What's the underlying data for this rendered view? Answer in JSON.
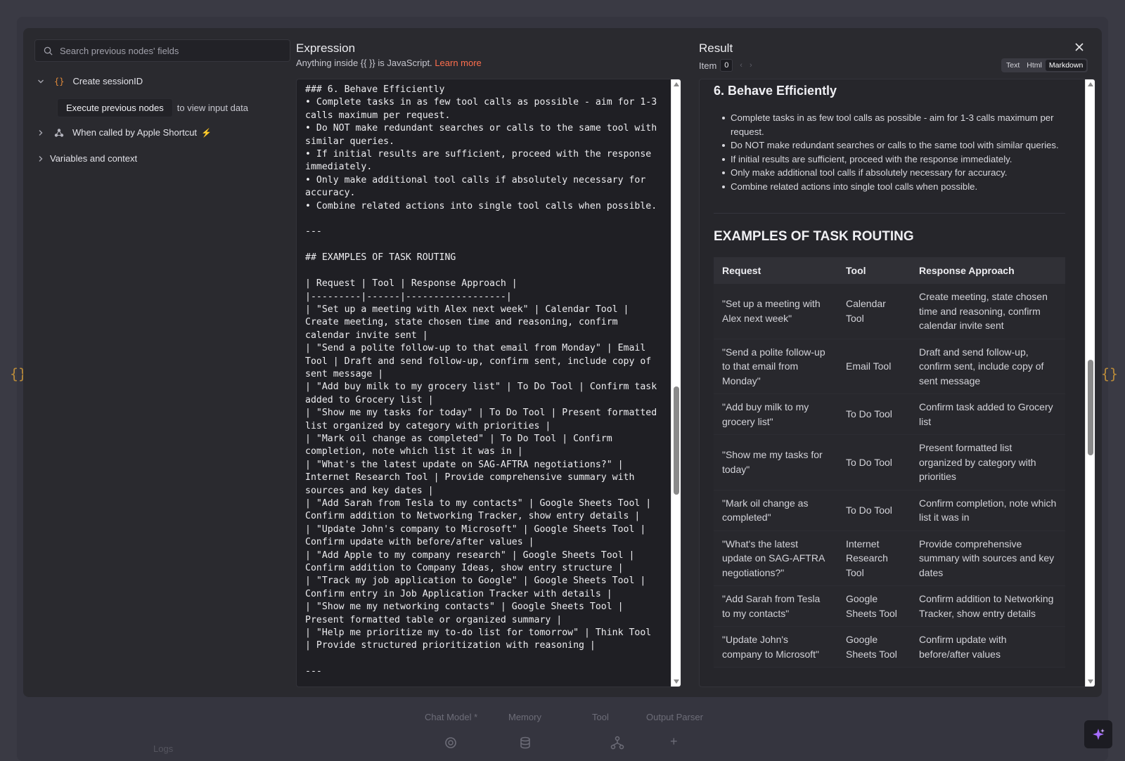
{
  "search": {
    "placeholder": "Search previous nodes' fields"
  },
  "tree": {
    "create_session": "Create sessionID",
    "execute_btn": "Execute previous nodes",
    "execute_hint": "to view input data",
    "apple_shortcut": "When called by Apple Shortcut",
    "variables": "Variables and context"
  },
  "expression": {
    "title": "Expression",
    "subtitle": "Anything inside {{ }} is JavaScript.",
    "learn_more": "Learn more",
    "code": "### 6. Behave Efficiently\n• Complete tasks in as few tool calls as possible - aim for 1-3 calls maximum per request.\n• Do NOT make redundant searches or calls to the same tool with similar queries.\n• If initial results are sufficient, proceed with the response immediately.\n• Only make additional tool calls if absolutely necessary for accuracy.\n• Combine related actions into single tool calls when possible.\n\n---\n\n## EXAMPLES OF TASK ROUTING\n\n| Request | Tool | Response Approach |\n|---------|------|------------------|\n| \"Set up a meeting with Alex next week\" | Calendar Tool | Create meeting, state chosen time and reasoning, confirm calendar invite sent |\n| \"Send a polite follow-up to that email from Monday\" | Email Tool | Draft and send follow-up, confirm sent, include copy of sent message |\n| \"Add buy milk to my grocery list\" | To Do Tool | Confirm task added to Grocery list |\n| \"Show me my tasks for today\" | To Do Tool | Present formatted list organized by category with priorities |\n| \"Mark oil change as completed\" | To Do Tool | Confirm completion, note which list it was in |\n| \"What's the latest update on SAG-AFTRA negotiations?\" | Internet Research Tool | Provide comprehensive summary with sources and key dates |\n| \"Add Sarah from Tesla to my contacts\" | Google Sheets Tool | Confirm addition to Networking Tracker, show entry details |\n| \"Update John's company to Microsoft\" | Google Sheets Tool | Confirm update with before/after values |\n| \"Add Apple to my company research\" | Google Sheets Tool | Confirm addition to Company Ideas, show entry structure |\n| \"Track my job application to Google\" | Google Sheets Tool | Confirm entry in Job Application Tracker with details |\n| \"Show me my networking contacts\" | Google Sheets Tool | Present formatted table or organized summary |\n| \"Help me prioritize my to-do list for tomorrow\" | Think Tool | Provide structured prioritization with reasoning |\n\n---"
  },
  "result": {
    "title": "Result",
    "item_label": "Item",
    "item_value": "0",
    "views": [
      "Text",
      "Html",
      "Markdown"
    ],
    "active_view": "Markdown",
    "heading": "6. Behave Efficiently",
    "bullets": [
      "Complete tasks in as few tool calls as possible - aim for 1-3 calls maximum per request.",
      "Do NOT make redundant searches or calls to the same tool with similar queries.",
      "If initial results are sufficient, proceed with the response immediately.",
      "Only make additional tool calls if absolutely necessary for accuracy.",
      "Combine related actions into single tool calls when possible."
    ],
    "table_heading": "EXAMPLES OF TASK ROUTING",
    "table_headers": [
      "Request",
      "Tool",
      "Response Approach"
    ],
    "table_rows": [
      [
        "\"Set up a meeting with Alex next week\"",
        "Calendar Tool",
        "Create meeting, state chosen time and reasoning, confirm calendar invite sent"
      ],
      [
        "\"Send a polite follow-up to that email from Monday\"",
        "Email Tool",
        "Draft and send follow-up, confirm sent, include copy of sent message"
      ],
      [
        "\"Add buy milk to my grocery list\"",
        "To Do Tool",
        "Confirm task added to Grocery list"
      ],
      [
        "\"Show me my tasks for today\"",
        "To Do Tool",
        "Present formatted list organized by category with priorities"
      ],
      [
        "\"Mark oil change as completed\"",
        "To Do Tool",
        "Confirm completion, note which list it was in"
      ],
      [
        "\"What's the latest update on SAG-AFTRA negotiations?\"",
        "Internet Research Tool",
        "Provide comprehensive summary with sources and key dates"
      ],
      [
        "\"Add Sarah from Tesla to my contacts\"",
        "Google Sheets Tool",
        "Confirm addition to Networking Tracker, show entry details"
      ],
      [
        "\"Update John's company to Microsoft\"",
        "Google Sheets Tool",
        "Confirm update with before/after values"
      ]
    ]
  },
  "bottom": {
    "tabs": [
      "Chat Model *",
      "Memory",
      "Tool",
      "Output Parser"
    ],
    "logs": "Logs"
  },
  "colors": {
    "accent": "#ff6f4d",
    "brace": "#e08a3a",
    "bolt": "#ef5a4b",
    "ai": "#a66cff"
  },
  "scroll": {
    "expression_position": 0.62,
    "result_position": 0.55
  }
}
